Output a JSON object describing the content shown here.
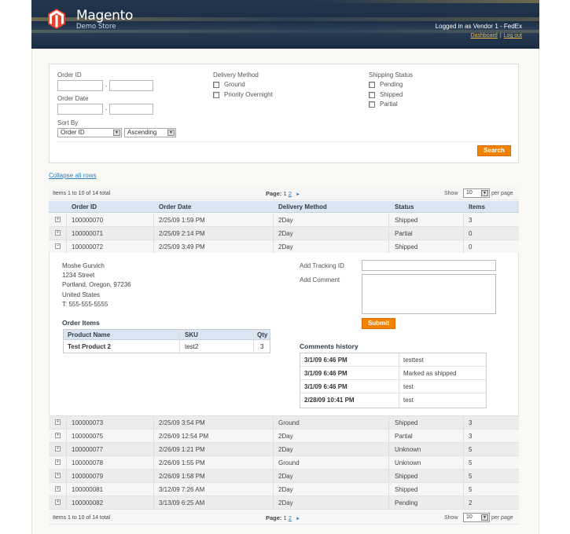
{
  "header": {
    "brand": "Magento",
    "store_name": "Demo Store",
    "logged_in_text": "Logged in as Vendor 1 - FedEx",
    "links": {
      "dashboard": "Dashboard",
      "separator": "|",
      "logout": "Log out"
    }
  },
  "filters": {
    "order_id": {
      "label": "Order ID",
      "from": "",
      "to": "",
      "dash": "-"
    },
    "order_date": {
      "label": "Order Date",
      "from": "",
      "to": "",
      "dash": "-"
    },
    "sort_by": {
      "label": "Sort By",
      "field": "Order ID",
      "direction": "Ascending"
    },
    "delivery_method": {
      "label": "Delivery Method",
      "options": [
        {
          "label": "Ground",
          "checked": false
        },
        {
          "label": "Priority Overnight",
          "checked": false
        }
      ]
    },
    "shipping_status": {
      "label": "Shipping Status",
      "options": [
        {
          "label": "Pending",
          "checked": false
        },
        {
          "label": "Shipped",
          "checked": false
        },
        {
          "label": "Partial",
          "checked": false
        }
      ]
    },
    "search_button": "Search"
  },
  "collapse_all": "Collapse all rows",
  "pager": {
    "items_text": "Items 1 to 10 of 14 total",
    "page_label": "Page:",
    "current_page": "1",
    "next_page": "2",
    "next_arrow": "►",
    "show_label": "Show",
    "per_page_value": "10",
    "per_page_label": "per page"
  },
  "grid": {
    "columns": [
      "Order ID",
      "Order Date",
      "Delivery Method",
      "Status",
      "Items"
    ],
    "rows": [
      {
        "toggle": "+",
        "order_id": "100000070",
        "date": "2/25/09 1:59 PM",
        "method": "2Day",
        "status": "Shipped",
        "items": "3"
      },
      {
        "toggle": "+",
        "order_id": "100000071",
        "date": "2/25/09 2:14 PM",
        "method": "2Day",
        "status": "Partial",
        "items": "0"
      },
      {
        "toggle": "−",
        "order_id": "100000072",
        "date": "2/25/09 3:49 PM",
        "method": "2Day",
        "status": "Shipped",
        "items": "0"
      },
      {
        "toggle": "+",
        "order_id": "100000073",
        "date": "2/25/09 3:54 PM",
        "method": "Ground",
        "status": "Shipped",
        "items": "3"
      },
      {
        "toggle": "+",
        "order_id": "100000075",
        "date": "2/26/09 12:54 PM",
        "method": "2Day",
        "status": "Partial",
        "items": "3"
      },
      {
        "toggle": "+",
        "order_id": "100000077",
        "date": "2/26/09 1:21 PM",
        "method": "2Day",
        "status": "Unknown",
        "items": "5"
      },
      {
        "toggle": "+",
        "order_id": "100000078",
        "date": "2/26/09 1:55 PM",
        "method": "Ground",
        "status": "Unknown",
        "items": "5"
      },
      {
        "toggle": "+",
        "order_id": "100000079",
        "date": "2/26/09 1:58 PM",
        "method": "2Day",
        "status": "Shipped",
        "items": "5"
      },
      {
        "toggle": "+",
        "order_id": "100000081",
        "date": "3/12/09 7:26 AM",
        "method": "2Day",
        "status": "Shipped",
        "items": "5"
      },
      {
        "toggle": "+",
        "order_id": "100000082",
        "date": "3/13/09 6:25 AM",
        "method": "2Day",
        "status": "Pending",
        "items": "2"
      }
    ]
  },
  "detail": {
    "address": [
      "Moshe Gurvich",
      "1234 Street",
      "Portland, Oregon, 97236",
      "United States",
      "T: 555-555-5555"
    ],
    "order_items_title": "Order Items",
    "order_items_columns": [
      "Product Name",
      "SKU",
      "Qty"
    ],
    "order_items": [
      {
        "name": "Test Product 2",
        "sku": "test2",
        "qty": "3"
      }
    ],
    "tracking_label": "Add Tracking ID",
    "tracking_value": "",
    "comment_label": "Add Comment",
    "comment_value": "",
    "submit_button": "Submit",
    "comments_title": "Comments history",
    "comments": [
      {
        "date": "3/1/09 6:46 PM",
        "text": "testtest"
      },
      {
        "date": "3/1/09 6:46 PM",
        "text": "Marked as shipped"
      },
      {
        "date": "3/1/09 6:46 PM",
        "text": "test"
      },
      {
        "date": "2/28/09 10:41 PM",
        "text": "test"
      }
    ]
  },
  "colors": {
    "header_bg": "#1c2f47",
    "accent_orange": "#f18200",
    "link_blue": "#2b7ec1",
    "grid_header": "#d9e5f0",
    "header_link": "#e9b94a"
  }
}
